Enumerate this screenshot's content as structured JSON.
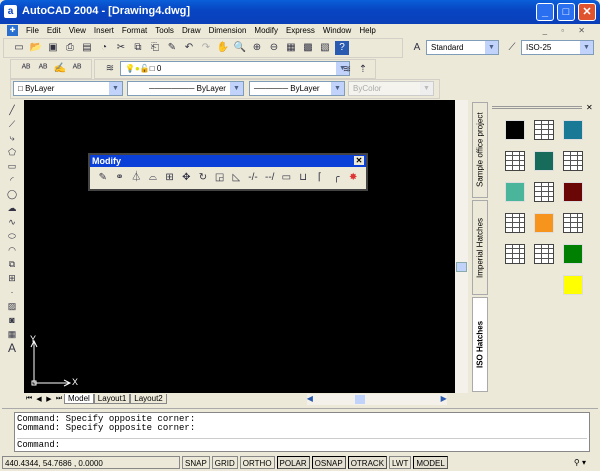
{
  "window": {
    "title": "AutoCAD 2004 - [Drawing4.dwg]",
    "app_icon": "a"
  },
  "menu": [
    "File",
    "Edit",
    "View",
    "Insert",
    "Format",
    "Tools",
    "Draw",
    "Dimension",
    "Modify",
    "Express",
    "Window",
    "Help"
  ],
  "toolbar": {
    "text_style": "Standard",
    "dim_style": "ISO-25",
    "layer": "0",
    "color": "ByLayer",
    "linetype": "ByLayer",
    "lineweight": "ByLayer",
    "plot_style": "ByColor"
  },
  "modify_toolbar": {
    "title": "Modify",
    "close": "✕"
  },
  "layout_tabs": [
    "Model",
    "Layout1",
    "Layout2"
  ],
  "ucs": {
    "x": "X",
    "y": "Y"
  },
  "palette": {
    "tabs": [
      "Sample office project",
      "Imperial Hatches",
      "ISO Hatches"
    ],
    "active_tab": "ISO Hatches",
    "swatch_colors": [
      "#000000",
      "#ffffff",
      "#1a7a96",
      "#ffffff",
      "#176b5a",
      "#ffffff",
      "#4ab59a",
      "#ffffff",
      "#6b0606",
      "#ffffff",
      "#f7941d",
      "#ffffff",
      "#ffffff",
      "#ffffff",
      "#008000",
      "#ffff00"
    ]
  },
  "command": {
    "history": [
      "Command: Specify opposite corner:",
      "Command: Specify opposite corner:"
    ],
    "prompt": "Command:"
  },
  "status": {
    "coords": "440.4344, 54.7686 , 0.0000",
    "buttons": [
      "SNAP",
      "GRID",
      "ORTHO",
      "POLAR",
      "OSNAP",
      "OTRACK",
      "LWT",
      "MODEL"
    ]
  }
}
